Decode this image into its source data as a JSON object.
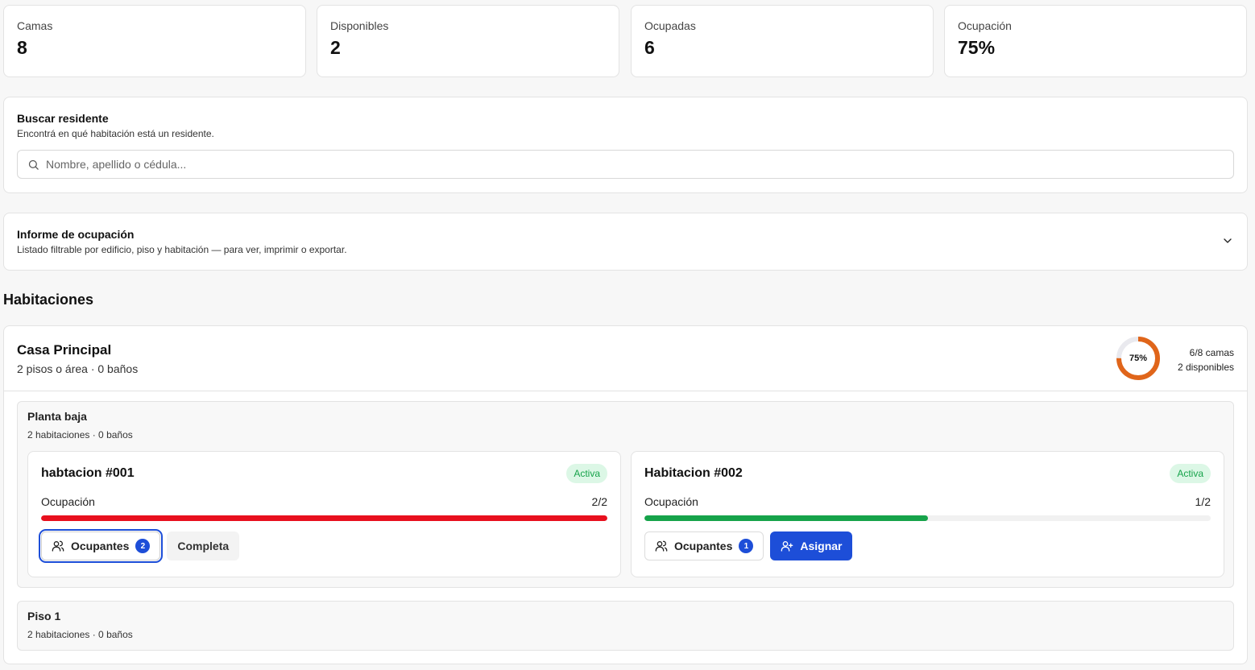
{
  "stats": [
    {
      "label": "Camas",
      "value": "8"
    },
    {
      "label": "Disponibles",
      "value": "2"
    },
    {
      "label": "Ocupadas",
      "value": "6"
    },
    {
      "label": "Ocupación",
      "value": "75%"
    }
  ],
  "search": {
    "title": "Buscar residente",
    "subtitle": "Encontrá en qué habitación está un residente.",
    "placeholder": "Nombre, apellido o cédula..."
  },
  "report": {
    "title": "Informe de ocupación",
    "subtitle": "Listado filtrable por edificio, piso y habitación — para ver, imprimir o exportar."
  },
  "rooms_section": {
    "title": "Habitaciones",
    "building": {
      "name": "Casa Principal",
      "subtitle": "2 pisos o área · 0 baños",
      "occupancy_pct": "75%",
      "occupancy_value": 0.75,
      "beds": "6/8 camas",
      "available": "2 disponibles",
      "floors": [
        {
          "name": "Planta baja",
          "subtitle": "2 habitaciones · 0 baños",
          "rooms": [
            {
              "name": "habtacion #001",
              "status": "Activa",
              "occupancy_label": "Ocupación",
              "occupancy": "2/2",
              "fill": 1.0,
              "fill_color": "#e8101e",
              "occupants_label": "Ocupantes",
              "occupants_count": "2",
              "secondary_label": "Completa"
            },
            {
              "name": "Habitacion #002",
              "status": "Activa",
              "occupancy_label": "Ocupación",
              "occupancy": "1/2",
              "fill": 0.5,
              "fill_color": "#16a34a",
              "occupants_label": "Ocupantes",
              "occupants_count": "1",
              "secondary_label": "Asignar"
            }
          ]
        },
        {
          "name": "Piso 1",
          "subtitle": "2 habitaciones · 0 baños"
        }
      ]
    }
  },
  "colors": {
    "accent": "#1d4ed8",
    "donut": "#e0651a",
    "donut_track": "#e9e9ee",
    "active_badge_bg": "#dcf7e6",
    "active_badge_fg": "#16a34a"
  }
}
